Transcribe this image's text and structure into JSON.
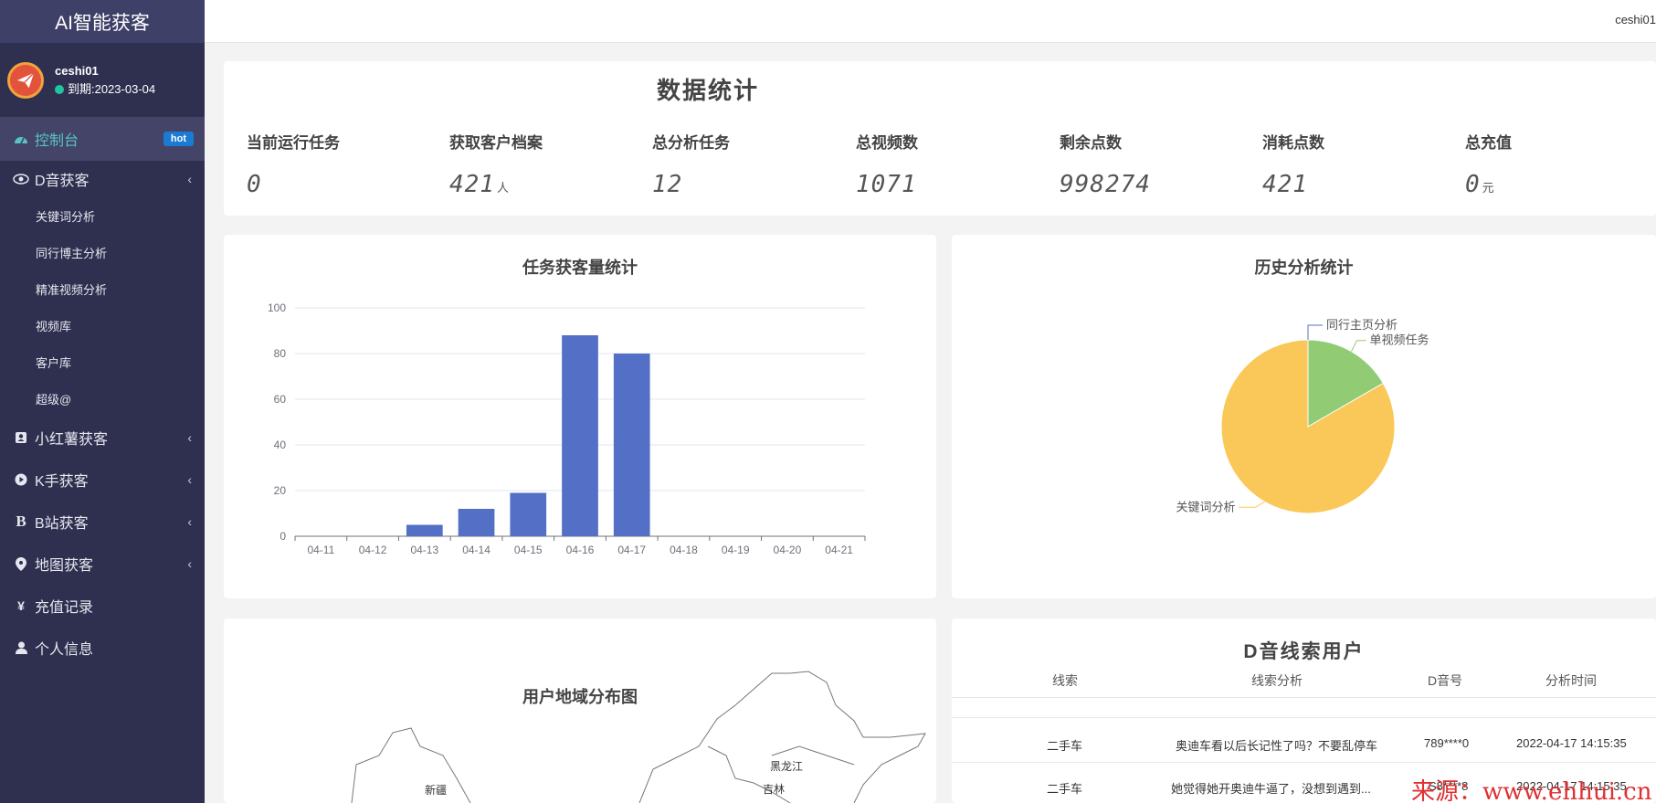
{
  "app": {
    "brand": "AI智能获客"
  },
  "user": {
    "name": "ceshi01",
    "expiry": "到期:2023-03-04",
    "top_name": "ceshi01"
  },
  "sidebar": {
    "items": [
      {
        "label": "控制台",
        "badge": "hot",
        "icon": "dashboard-icon"
      },
      {
        "label": "D音获客",
        "icon": "eye-icon"
      },
      {
        "label": "小红薯获客",
        "icon": "contact-icon"
      },
      {
        "label": "K手获客",
        "icon": "play-icon"
      },
      {
        "label": "B站获客",
        "icon": "bold-b-icon"
      },
      {
        "label": "地图获客",
        "icon": "map-pin-icon"
      },
      {
        "label": "充值记录",
        "icon": "yen-icon"
      },
      {
        "label": "个人信息",
        "icon": "user-icon"
      }
    ],
    "sub_items": [
      "关键词分析",
      "同行博主分析",
      "精准视频分析",
      "视频库",
      "客户库",
      "超级@"
    ]
  },
  "stats": {
    "title": "数据统计",
    "items": [
      {
        "label": "当前运行任务",
        "value": "0",
        "unit": ""
      },
      {
        "label": "获取客户档案",
        "value": "421",
        "unit": "人"
      },
      {
        "label": "总分析任务",
        "value": "12",
        "unit": ""
      },
      {
        "label": "总视频数",
        "value": "1071",
        "unit": ""
      },
      {
        "label": "剩余点数",
        "value": "998274",
        "unit": ""
      },
      {
        "label": "消耗点数",
        "value": "421",
        "unit": ""
      },
      {
        "label": "总充值",
        "value": "0",
        "unit": "元"
      }
    ]
  },
  "bar_chart": {
    "title": "任务获客量统计"
  },
  "pie_chart": {
    "title": "历史分析统计"
  },
  "map": {
    "title": "用户地域分布图",
    "labels": [
      "新疆",
      "黑龙江",
      "吉林"
    ]
  },
  "table": {
    "title": "D音线索用户",
    "headers": [
      "线索",
      "线索分析",
      "D音号",
      "分析时间"
    ],
    "rows": [
      [
        "二手车",
        "奥迪车看以后长记性了吗？不要乱停车",
        "789****0",
        "2022-04-17 14:15:35"
      ],
      [
        "二手车",
        "她觉得她开奥迪牛逼了，没想到遇到...",
        "S8****8",
        "2022-04-17 14:15:35"
      ]
    ]
  },
  "watermark": "来源：www.ehhui.cn",
  "colors": {
    "sidebar": "#2f3050",
    "brand_bg": "#3f4067",
    "active_text": "#59c3c3",
    "bar": "#5470c6",
    "pie_yellow": "#fac858",
    "pie_green": "#91cc75",
    "hot_badge": "#1b7bd3"
  },
  "chart_data": [
    {
      "type": "bar",
      "title": "任务获客量统计",
      "categories": [
        "04-11",
        "04-12",
        "04-13",
        "04-14",
        "04-15",
        "04-16",
        "04-17",
        "04-18",
        "04-19",
        "04-20",
        "04-21"
      ],
      "values": [
        0,
        0,
        5,
        12,
        19,
        88,
        80,
        0,
        0,
        0,
        0
      ],
      "ylim": [
        0,
        100
      ],
      "yticks": [
        0,
        20,
        40,
        60,
        80,
        100
      ],
      "grid": true
    },
    {
      "type": "pie",
      "title": "历史分析统计",
      "labels": [
        "同行主页分析",
        "单视频任务",
        "关键词分析"
      ],
      "values": [
        0,
        2,
        10
      ]
    }
  ]
}
